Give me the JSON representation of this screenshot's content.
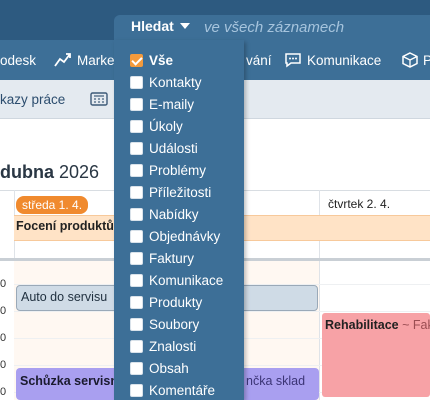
{
  "nav": {
    "items": [
      {
        "label": "odesk",
        "icon": "gear-icon"
      },
      {
        "label": "Marke",
        "icon": "chart-icon"
      },
      {
        "label": "vání",
        "icon": ""
      },
      {
        "label": "Komunikace",
        "icon": "chat-icon"
      },
      {
        "label": "P",
        "icon": "box-icon"
      }
    ]
  },
  "subbar": {
    "left_label": "kazy práce",
    "icon": "calculator-icon"
  },
  "search": {
    "label": "Hledat",
    "placeholder": "ve všech záznamech",
    "options": [
      {
        "label": "Vše",
        "checked": true
      },
      {
        "label": "Kontakty",
        "checked": false
      },
      {
        "label": "E-maily",
        "checked": false
      },
      {
        "label": "Úkoly",
        "checked": false
      },
      {
        "label": "Události",
        "checked": false
      },
      {
        "label": "Problémy",
        "checked": false
      },
      {
        "label": "Příležitosti",
        "checked": false
      },
      {
        "label": "Nabídky",
        "checked": false
      },
      {
        "label": "Objednávky",
        "checked": false
      },
      {
        "label": "Faktury",
        "checked": false
      },
      {
        "label": "Komunikace",
        "checked": false
      },
      {
        "label": "Produkty",
        "checked": false
      },
      {
        "label": "Soubory",
        "checked": false
      },
      {
        "label": "Znalosti",
        "checked": false
      },
      {
        "label": "Obsah",
        "checked": false
      },
      {
        "label": "Komentáře",
        "checked": false
      }
    ]
  },
  "calendar": {
    "title_bold": "dubna",
    "title_year": "2026",
    "day1": "středa 1. 4.",
    "day2": "čtvrtek 2. 4.",
    "time_labels": [
      "0",
      "0",
      "0",
      "0",
      "0"
    ],
    "events": {
      "allday": "Focení produktů",
      "auto": "Auto do servisu",
      "rehab_title": "Rehabilitace",
      "rehab_sep": "~",
      "rehab_rest": "Fak",
      "schuzka": "Schůzka servisn",
      "schuzka_rest": "nčka sklad"
    }
  },
  "colors": {
    "topbar": "#2d5a80",
    "navbar": "#3d6f97",
    "accent": "#f39a3c"
  }
}
